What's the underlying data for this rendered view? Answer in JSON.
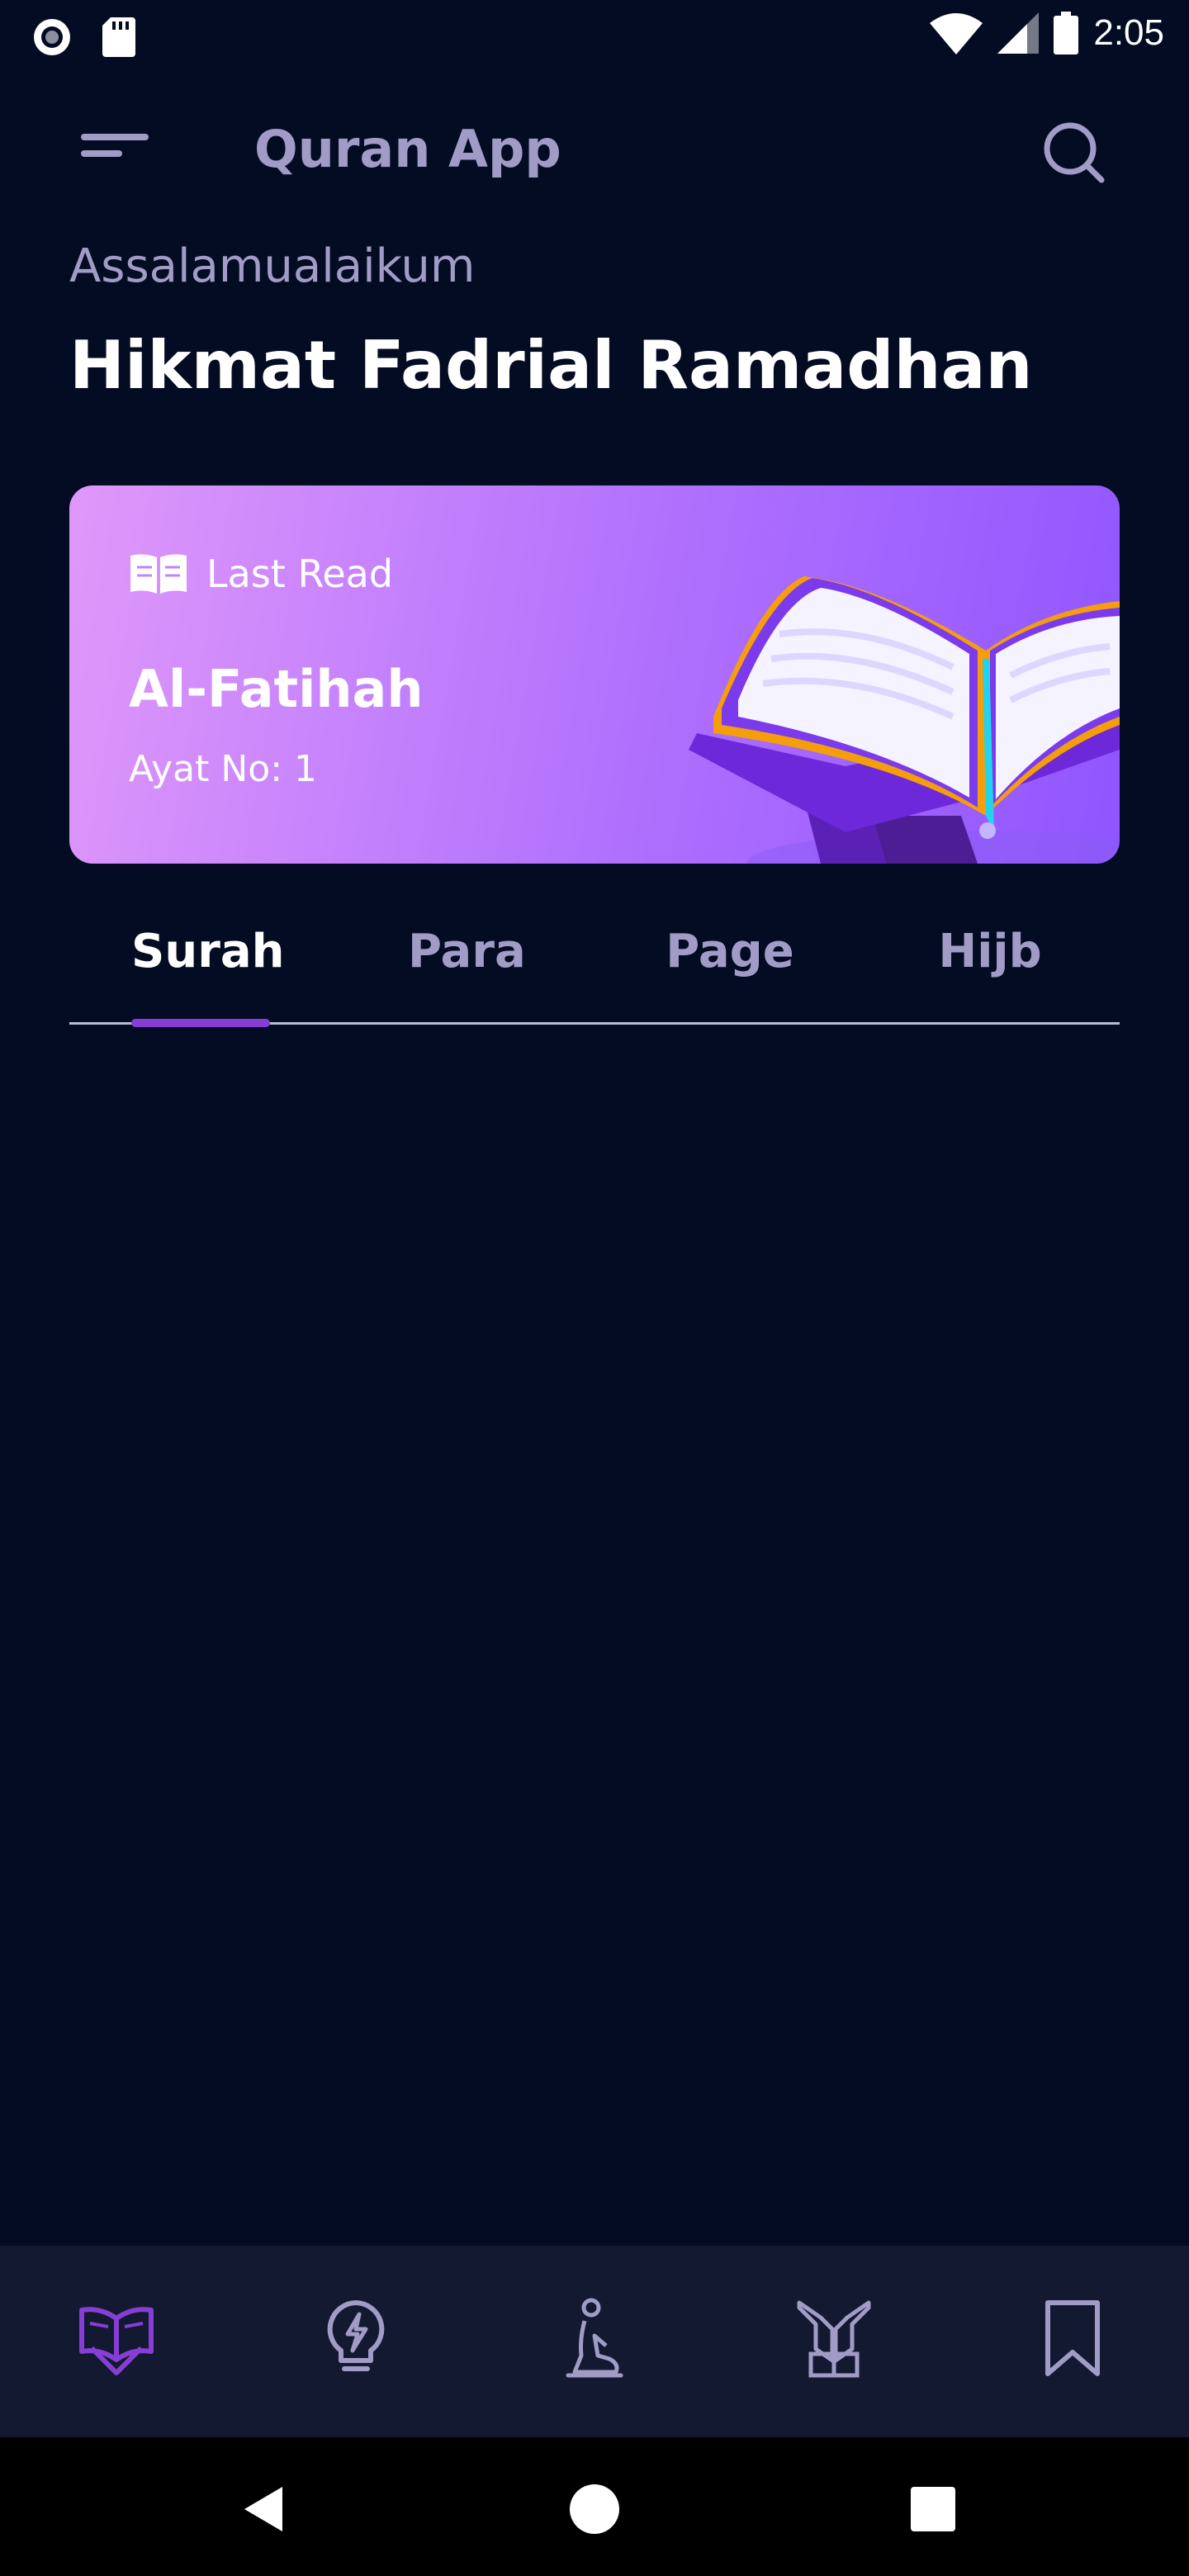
{
  "status_bar": {
    "time": "2:05",
    "icons": [
      "record-icon",
      "sd-card-icon",
      "wifi-icon",
      "cell-signal-icon",
      "battery-icon"
    ]
  },
  "app_bar": {
    "title": "Quran App",
    "menu_icon": "menu-icon",
    "search_icon": "search-icon",
    "title_color": "#A19CC5"
  },
  "greeting": {
    "salutation": "Assalamualaikum",
    "user_name": "Hikmat Fadrial Ramadhan"
  },
  "last_read": {
    "label": "Last Read",
    "surah": "Al-Fatihah",
    "ayat": "Ayat No: 1",
    "icon": "open-book-icon",
    "gradient_start": "#DF98FA",
    "gradient_end": "#9055FF"
  },
  "tabs": [
    {
      "label": "Surah",
      "active": true
    },
    {
      "label": "Para",
      "active": false
    },
    {
      "label": "Page",
      "active": false
    },
    {
      "label": "Hijb",
      "active": false
    }
  ],
  "bottom_nav": {
    "items": [
      {
        "icon": "quran-book-icon",
        "active": true
      },
      {
        "icon": "lightbulb-icon",
        "active": false
      },
      {
        "icon": "prayer-person-icon",
        "active": false
      },
      {
        "icon": "praying-hands-icon",
        "active": false
      },
      {
        "icon": "bookmark-icon",
        "active": false
      }
    ],
    "active_color": "#863ED5"
  },
  "system_nav": {
    "icons": [
      "back-icon",
      "home-icon",
      "recents-icon"
    ]
  },
  "colors": {
    "background": "#040C23",
    "accent": "#863ED5",
    "muted_text": "#A19CC5"
  }
}
